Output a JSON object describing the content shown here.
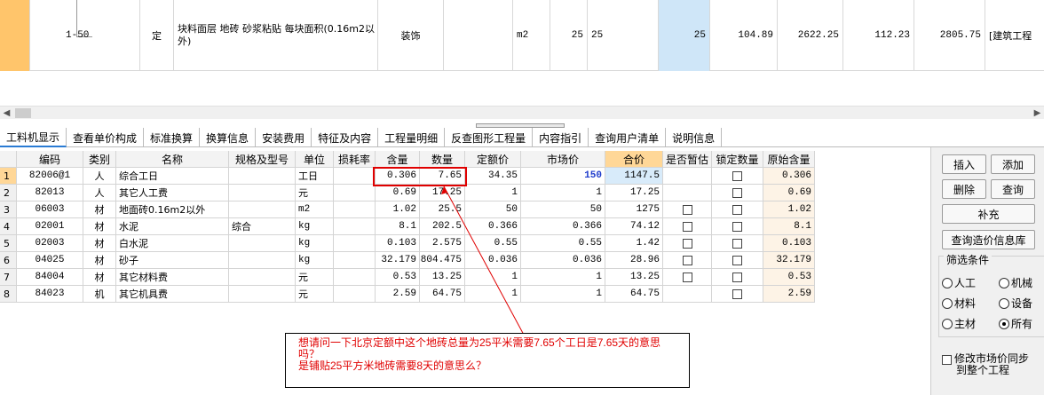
{
  "top_row": {
    "code": "1-50",
    "type": "定",
    "name": "块料面层 地砖 砂浆粘贴 每块面积(0.16m2以外)",
    "category": "装饰",
    "unit": "m2",
    "qty_expr": "25",
    "qty_formula": "25",
    "quantity": "25",
    "unit_price": "104.89",
    "total": "2622.25",
    "unit_price2": "112.23",
    "total2": "2805.75",
    "spec": "[建筑工程"
  },
  "tabs": [
    "工料机显示",
    "查看单价构成",
    "标准换算",
    "换算信息",
    "安装费用",
    "特征及内容",
    "工程量明细",
    "反查图形工程量",
    "内容指引",
    "查询用户清单",
    "说明信息"
  ],
  "grid": {
    "headers": [
      "编码",
      "类别",
      "名称",
      "规格及型号",
      "单位",
      "损耗率",
      "含量",
      "数量",
      "定额价",
      "市场价",
      "合价",
      "是否暂估",
      "锁定数量",
      "原始含量"
    ],
    "rows": [
      {
        "n": "1",
        "code": "82006@1",
        "cat": "人",
        "name": "综合工日",
        "spec": "",
        "unit": "工日",
        "loss": "",
        "content": "0.306",
        "qty": "7.65",
        "quota": "34.35",
        "market": "150",
        "sum": "1147.5",
        "est": false,
        "lock": true,
        "orig": "0.306"
      },
      {
        "n": "2",
        "code": "82013",
        "cat": "人",
        "name": "其它人工费",
        "spec": "",
        "unit": "元",
        "loss": "",
        "content": "0.69",
        "qty": "17.25",
        "quota": "1",
        "market": "1",
        "sum": "17.25",
        "est": false,
        "lock": true,
        "orig": "0.69"
      },
      {
        "n": "3",
        "code": "06003",
        "cat": "材",
        "name": "地面砖0.16m2以外",
        "spec": "",
        "unit": "m2",
        "loss": "",
        "content": "1.02",
        "qty": "25.5",
        "quota": "50",
        "market": "50",
        "sum": "1275",
        "est": true,
        "lock": true,
        "orig": "1.02"
      },
      {
        "n": "4",
        "code": "02001",
        "cat": "材",
        "name": "水泥",
        "spec": "综合",
        "unit": "kg",
        "loss": "",
        "content": "8.1",
        "qty": "202.5",
        "quota": "0.366",
        "market": "0.366",
        "sum": "74.12",
        "est": true,
        "lock": true,
        "orig": "8.1"
      },
      {
        "n": "5",
        "code": "02003",
        "cat": "材",
        "name": "白水泥",
        "spec": "",
        "unit": "kg",
        "loss": "",
        "content": "0.103",
        "qty": "2.575",
        "quota": "0.55",
        "market": "0.55",
        "sum": "1.42",
        "est": true,
        "lock": true,
        "orig": "0.103"
      },
      {
        "n": "6",
        "code": "04025",
        "cat": "材",
        "name": "砂子",
        "spec": "",
        "unit": "kg",
        "loss": "",
        "content": "32.179",
        "qty": "804.475",
        "quota": "0.036",
        "market": "0.036",
        "sum": "28.96",
        "est": true,
        "lock": true,
        "orig": "32.179"
      },
      {
        "n": "7",
        "code": "84004",
        "cat": "材",
        "name": "其它材料费",
        "spec": "",
        "unit": "元",
        "loss": "",
        "content": "0.53",
        "qty": "13.25",
        "quota": "1",
        "market": "1",
        "sum": "13.25",
        "est": true,
        "lock": true,
        "orig": "0.53"
      },
      {
        "n": "8",
        "code": "84023",
        "cat": "机",
        "name": "其它机具费",
        "spec": "",
        "unit": "元",
        "loss": "",
        "content": "2.59",
        "qty": "64.75",
        "quota": "1",
        "market": "1",
        "sum": "64.75",
        "est": false,
        "lock": true,
        "orig": "2.59"
      }
    ]
  },
  "annotation": {
    "line1": "想请问一下北京定额中这个地砖总量为25平米需要7.65个工日是7.65天的意思吗？",
    "line2": "是铺贴25平方米地砖需要8天的意思么？"
  },
  "panel": {
    "insert": "插入",
    "add": "添加",
    "delete": "删除",
    "query": "查询",
    "supplement": "补充",
    "query_price_db": "查询造价信息库",
    "filter_title": "筛选条件",
    "radios": [
      {
        "label": "人工",
        "checked": false
      },
      {
        "label": "机械",
        "checked": false
      },
      {
        "label": "材料",
        "checked": false
      },
      {
        "label": "设备",
        "checked": false
      },
      {
        "label": "主材",
        "checked": false
      },
      {
        "label": "所有",
        "checked": true
      }
    ],
    "sync_line1": "修改市场价同步",
    "sync_line2": "到整个工程"
  },
  "colors": {
    "highlight": "#e00000",
    "market_price": "#1f3ccc",
    "header_gold": "#ffd797"
  }
}
